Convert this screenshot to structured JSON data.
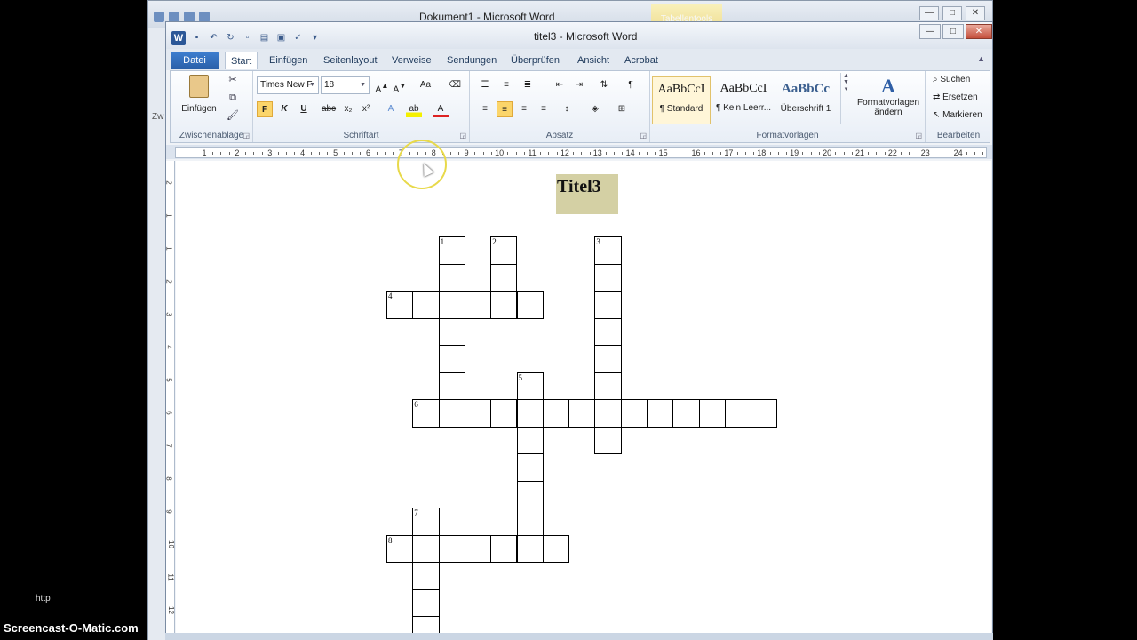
{
  "background_window": {
    "title": "Dokument1 - Microsoft Word",
    "tools_label": "Tabellentools",
    "left_text": "Zw"
  },
  "window": {
    "title": "titel3 - Microsoft Word",
    "app_icon": "W"
  },
  "tabs": [
    {
      "label": "Datei"
    },
    {
      "label": "Start"
    },
    {
      "label": "Einfügen"
    },
    {
      "label": "Seitenlayout"
    },
    {
      "label": "Verweise"
    },
    {
      "label": "Sendungen"
    },
    {
      "label": "Überprüfen"
    },
    {
      "label": "Ansicht"
    },
    {
      "label": "Acrobat"
    }
  ],
  "ribbon": {
    "clipboard": {
      "label": "Zwischenablage",
      "paste_label": "Einfügen"
    },
    "font": {
      "label": "Schriftart",
      "font_name": "Times New F",
      "font_size": "18",
      "bold": "F",
      "italic": "K",
      "underline": "U",
      "strike": "abc"
    },
    "paragraph": {
      "label": "Absatz"
    },
    "styles": {
      "label": "Formatvorlagen",
      "items": [
        {
          "sample": "AaBbCcI",
          "name": "¶ Standard"
        },
        {
          "sample": "AaBbCcI",
          "name": "¶ Kein Leerr..."
        },
        {
          "sample": "AaBbCc",
          "name": "Überschrift 1"
        }
      ],
      "change_label_1": "Formatvorlagen",
      "change_label_2": "ändern"
    },
    "editing": {
      "label": "Bearbeiten",
      "find": "Suchen",
      "replace": "Ersetzen",
      "select": "Markieren"
    }
  },
  "ruler_numbers": [
    "1",
    "2",
    "3",
    "4",
    "5",
    "6",
    "7",
    "8",
    "9",
    "10",
    "11",
    "12",
    "13",
    "14",
    "15",
    "16",
    "17",
    "18",
    "19",
    "20",
    "21",
    "22",
    "23",
    "24"
  ],
  "vruler_numbers": [
    "2",
    "1",
    "1",
    "2",
    "3",
    "4",
    "5",
    "6",
    "7",
    "8",
    "9",
    "10",
    "11",
    "12"
  ],
  "document": {
    "title": "Titel3"
  },
  "crossword": {
    "clue_numbers": [
      {
        "n": "1",
        "col": 2,
        "row": 0
      },
      {
        "n": "2",
        "col": 4,
        "row": 0
      },
      {
        "n": "3",
        "col": 8,
        "row": 0
      },
      {
        "n": "4",
        "col": 0,
        "row": 2
      },
      {
        "n": "5",
        "col": 5,
        "row": 5
      },
      {
        "n": "6",
        "col": 1,
        "row": 6
      },
      {
        "n": "7",
        "col": 1,
        "row": 10
      },
      {
        "n": "8",
        "col": 0,
        "row": 11
      }
    ],
    "cells": [
      [
        2,
        0
      ],
      [
        4,
        0
      ],
      [
        8,
        0
      ],
      [
        2,
        1
      ],
      [
        4,
        1
      ],
      [
        8,
        1
      ],
      [
        0,
        2
      ],
      [
        1,
        2
      ],
      [
        2,
        2
      ],
      [
        3,
        2
      ],
      [
        4,
        2
      ],
      [
        5,
        2
      ],
      [
        8,
        2
      ],
      [
        2,
        3
      ],
      [
        8,
        3
      ],
      [
        2,
        4
      ],
      [
        8,
        4
      ],
      [
        2,
        5
      ],
      [
        5,
        5
      ],
      [
        8,
        5
      ],
      [
        1,
        6
      ],
      [
        2,
        6
      ],
      [
        3,
        6
      ],
      [
        4,
        6
      ],
      [
        5,
        6
      ],
      [
        6,
        6
      ],
      [
        7,
        6
      ],
      [
        8,
        6
      ],
      [
        9,
        6
      ],
      [
        10,
        6
      ],
      [
        11,
        6
      ],
      [
        12,
        6
      ],
      [
        13,
        6
      ],
      [
        14,
        6
      ],
      [
        5,
        7
      ],
      [
        8,
        7
      ],
      [
        5,
        8
      ],
      [
        5,
        9
      ],
      [
        1,
        10
      ],
      [
        5,
        10
      ],
      [
        0,
        11
      ],
      [
        1,
        11
      ],
      [
        2,
        11
      ],
      [
        3,
        11
      ],
      [
        4,
        11
      ],
      [
        5,
        11
      ],
      [
        6,
        11
      ],
      [
        1,
        12
      ],
      [
        1,
        13
      ],
      [
        1,
        14
      ]
    ]
  },
  "overlay": {
    "watermark": "Screencast-O-Matic.com",
    "http": "http"
  }
}
